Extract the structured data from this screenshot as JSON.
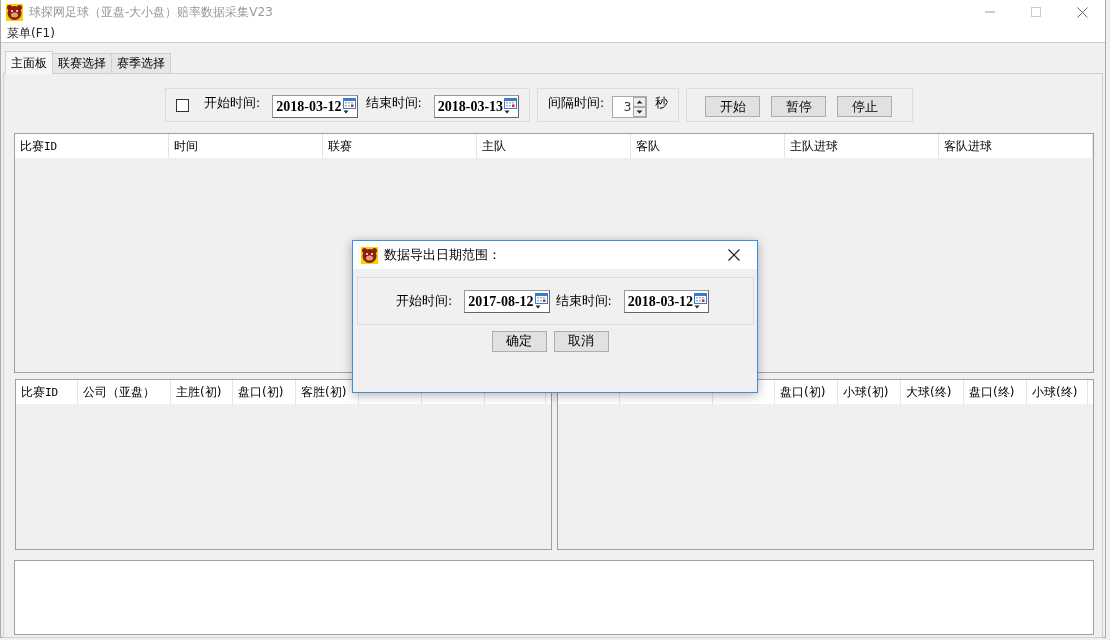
{
  "window": {
    "title": "球探网足球（亚盘-大小盘）赔率数据采集V23"
  },
  "menu": [
    "菜单(F1)"
  ],
  "tabs": [
    {
      "label": "主面板",
      "selected": true
    },
    {
      "label": "联赛选择",
      "selected": false
    },
    {
      "label": "赛季选择",
      "selected": false
    }
  ],
  "filter": {
    "checked": false,
    "start_label": "开始时间:",
    "start_date": "2018-03-12",
    "end_label": "结束时间:",
    "end_date": "2018-03-13"
  },
  "interval": {
    "label": "间隔时间:",
    "value": "3",
    "unit": "秒"
  },
  "buttons": [
    "开始",
    "暂停",
    "停止"
  ],
  "matches_table": {
    "columns": [
      "比赛ID",
      "时间",
      "联赛",
      "主队",
      "客队",
      "主队进球",
      "客队进球"
    ]
  },
  "asian_table": {
    "columns": [
      "比赛ID",
      "公司（亚盘）",
      "主胜(初)",
      "盘口(初)",
      "客胜(初)"
    ]
  },
  "over_under_table": {
    "columns": [
      "盘口(初)",
      "小球(初)",
      "大球(终)",
      "盘口(终)",
      "小球(终)"
    ]
  },
  "dialog": {
    "title": "数据导出日期范围：",
    "start_label": "开始时间:",
    "start_date": "2017-08-12",
    "end_label": "结束时间:",
    "end_date": "2018-03-12",
    "buttons": [
      "确定",
      "取消"
    ]
  }
}
